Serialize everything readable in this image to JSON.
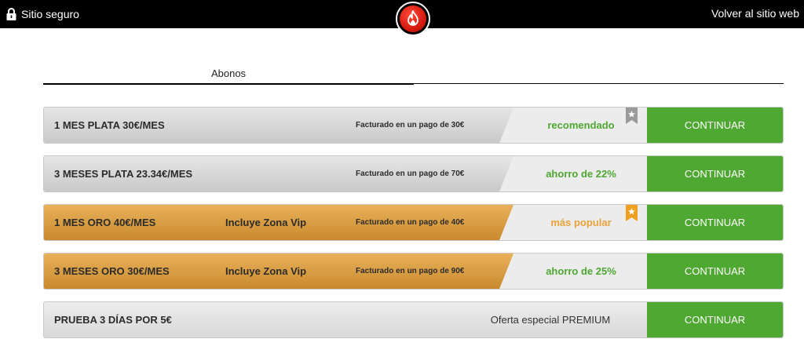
{
  "topbar": {
    "secure_label": "Sitio seguro",
    "back_label": "Volver al sitio web",
    "logo_color": "#d61a10"
  },
  "tabs": {
    "active": "Abonos"
  },
  "colors": {
    "green_text": "#4ea832",
    "orange_text": "#e8a33b",
    "button_green": "#4ea832",
    "gold": "#d89a3e",
    "silver": "#d6d6d6"
  },
  "plans": [
    {
      "title": "1 MES PLATA 30€/MES",
      "include": "",
      "billing": "Facturado en un pago de 30€",
      "tag": "recomendado",
      "tag_color": "#4ea832",
      "ribbon": "silver-star-ribbon-icon",
      "button": "CONTINUAR"
    },
    {
      "title": "3 MESES PLATA 23.34€/MES",
      "include": "",
      "billing": "Facturado en un pago de 70€",
      "tag": "ahorro de 22%",
      "tag_color": "#4ea832",
      "ribbon": "",
      "button": "CONTINUAR"
    },
    {
      "title": "1 MES ORO 40€/MES",
      "include": "Incluye Zona Vip",
      "billing": "Facturado en un pago de 40€",
      "tag": "más popular",
      "tag_color": "#e8a33b",
      "ribbon": "gold-star-ribbon-icon",
      "button": "CONTINUAR"
    },
    {
      "title": "3 MESES ORO 30€/MES",
      "include": "Incluye Zona Vip",
      "billing": "Facturado en un pago de 90€",
      "tag": "ahorro de 25%",
      "tag_color": "#4ea832",
      "ribbon": "",
      "button": "CONTINUAR"
    },
    {
      "title": "PRUEBA 3 DÍAS POR 5€",
      "offer": "Oferta especial PREMIUM",
      "button": "CONTINUAR"
    }
  ]
}
